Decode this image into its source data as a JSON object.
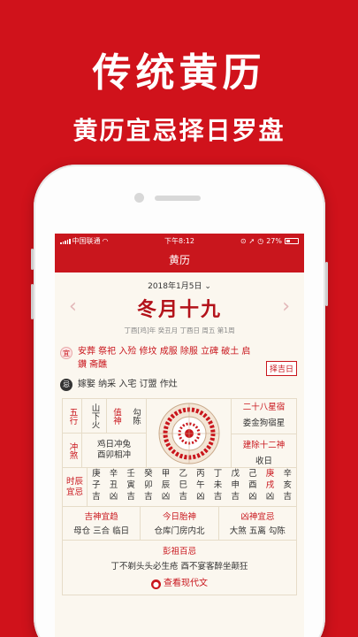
{
  "promo": {
    "title": "传统黄历",
    "subtitle": "黄历宜忌择日罗盘"
  },
  "status": {
    "carrier": "中国联通",
    "time": "下午8:12",
    "battery": "27%"
  },
  "nav": {
    "title": "黄历"
  },
  "date": {
    "gregorian": "2018年1月5日",
    "lunar": "冬月十九",
    "ganzhi": "丁酉[鸡]年 癸丑月 丁酉日 周五 第1周"
  },
  "yi": {
    "badge": "宜",
    "text": "安葬 祭祀 入殓 修坟 成服 除服 立碑 破土 启鑽 斋醮"
  },
  "choose_button": "择吉日",
  "ji": {
    "badge": "忌",
    "text": "嫁娶 纳采 入宅 订盟 作灶"
  },
  "wuxing": {
    "label": "五行",
    "value": "山下火"
  },
  "zhishen": {
    "label": "值神",
    "value": "勾陈"
  },
  "xingxiu": {
    "label": "二十八星宿",
    "value": "娄金狗宿星"
  },
  "chongsha": {
    "label": "冲煞",
    "line1": "鸡日冲兔",
    "line2": "酉卯相冲"
  },
  "jianchu": {
    "label": "建除十二神",
    "value": "收日"
  },
  "shichen": {
    "label": "时辰宜忌",
    "cols": [
      {
        "a": "庚",
        "b": "子",
        "c": "吉"
      },
      {
        "a": "辛",
        "b": "丑",
        "c": "凶"
      },
      {
        "a": "壬",
        "b": "寅",
        "c": "吉"
      },
      {
        "a": "癸",
        "b": "卯",
        "c": "吉"
      },
      {
        "a": "甲",
        "b": "辰",
        "c": "凶"
      },
      {
        "a": "乙",
        "b": "巳",
        "c": "吉"
      },
      {
        "a": "丙",
        "b": "午",
        "c": "凶"
      },
      {
        "a": "丁",
        "b": "未",
        "c": "吉"
      },
      {
        "a": "戊",
        "b": "申",
        "c": "吉"
      },
      {
        "a": "己",
        "b": "酉",
        "c": "凶"
      },
      {
        "a": "庚",
        "b": "戌",
        "c": "凶"
      },
      {
        "a": "辛",
        "b": "亥",
        "c": "吉"
      }
    ]
  },
  "jishen": {
    "label": "吉神宜趋",
    "value": "母仓 三合 临日"
  },
  "taishen": {
    "label": "今日胎神",
    "value": "仓库门房内北"
  },
  "xiongshen": {
    "label": "凶神宜忌",
    "value": "大煞 五离 勾陈"
  },
  "pengzu": {
    "label": "彭祖百忌",
    "value": "丁不剃头头必生疮 酉不宴客醉坐颠狂"
  },
  "more": {
    "label": "查看现代文"
  },
  "colors": {
    "brand_red": "#d0121b",
    "bar_red": "#c9161d",
    "paper": "#fbf7ef"
  }
}
